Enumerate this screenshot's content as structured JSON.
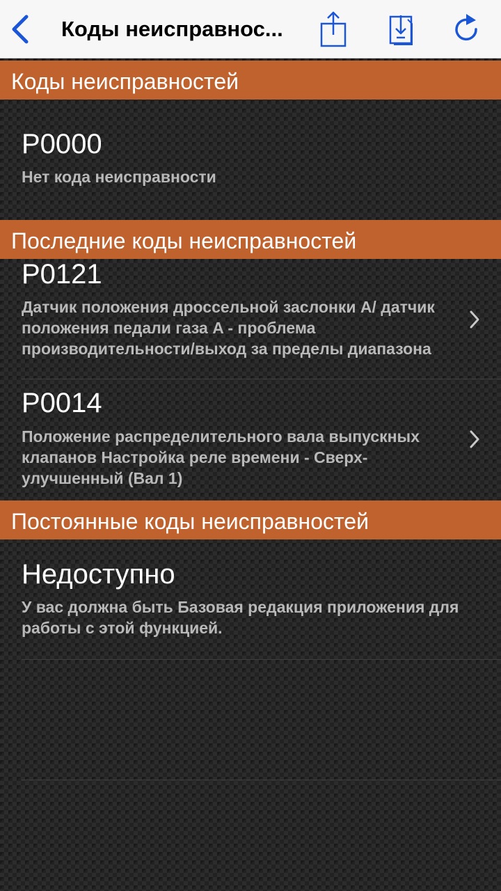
{
  "nav": {
    "title": "Коды неисправнос...",
    "back_icon": "chevron-left-icon",
    "share_icon": "share-icon",
    "save_icon": "download-icon",
    "refresh_icon": "refresh-icon",
    "accent_color": "#1a56d6"
  },
  "sections": {
    "current": {
      "header": "Коды неисправностей",
      "rows": [
        {
          "code": "P0000",
          "description": "Нет кода неисправности"
        }
      ]
    },
    "recent": {
      "header": "Последние коды неисправностей",
      "rows": [
        {
          "code": "P0121",
          "description": "Датчик положения дроссельной заслонки A/ датчик положения педали газа A - проблема производительности/выход за пределы диапазона"
        },
        {
          "code": "P0014",
          "description": "Положение распределительного вала выпускных клапанов Настройка реле времени - Сверх-улучшенный (Вал 1)"
        }
      ]
    },
    "permanent": {
      "header": "Постоянные коды неисправностей",
      "rows": [
        {
          "code": "Недоступно",
          "description": "У вас должна быть Базовая редакция приложения для работы с этой функцией."
        }
      ]
    }
  },
  "colors": {
    "section_header": "#c0622d",
    "code_text": "#ffffff",
    "description_text": "#b9b9b9"
  }
}
